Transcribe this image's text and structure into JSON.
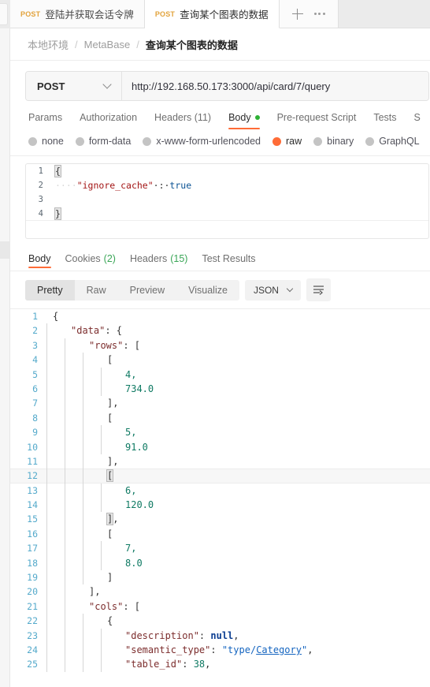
{
  "window": {
    "tabs": [
      {
        "method": "POST",
        "title": "登陆并获取会话令牌",
        "active": false
      },
      {
        "method": "POST",
        "title": "查询某个图表的数据",
        "active": true
      }
    ],
    "new_tab_icon": "plus-icon",
    "more_icon": "ellipsis-icon"
  },
  "breadcrumb": {
    "items": [
      "本地环境",
      "MetaBase",
      "查询某个图表的数据"
    ],
    "separator": "/"
  },
  "request": {
    "method": "POST",
    "url": "http://192.168.50.173:3000/api/card/7/query",
    "tabs": [
      {
        "label": "Params",
        "active": false
      },
      {
        "label": "Authorization",
        "active": false
      },
      {
        "label": "Headers (11)",
        "active": false
      },
      {
        "label": "Body",
        "active": true,
        "dot": true
      },
      {
        "label": "Pre-request Script",
        "active": false
      },
      {
        "label": "Tests",
        "active": false
      },
      {
        "label": "S",
        "active": false
      }
    ],
    "body_types": [
      {
        "label": "none",
        "selected": false
      },
      {
        "label": "form-data",
        "selected": false
      },
      {
        "label": "x-www-form-urlencoded",
        "selected": false
      },
      {
        "label": "raw",
        "selected": true
      },
      {
        "label": "binary",
        "selected": false
      },
      {
        "label": "GraphQL",
        "selected": false
      }
    ],
    "body_lines": [
      {
        "n": "1",
        "text": "{"
      },
      {
        "n": "2",
        "text": "    \"ignore_cache\" : true"
      },
      {
        "n": "3",
        "text": ""
      },
      {
        "n": "4",
        "text": "}"
      }
    ]
  },
  "response": {
    "tabs": [
      {
        "label": "Body",
        "active": true
      },
      {
        "label": "Cookies",
        "count": "(2)",
        "active": false
      },
      {
        "label": "Headers",
        "count": "(15)",
        "active": false
      },
      {
        "label": "Test Results",
        "active": false
      }
    ],
    "view_modes": [
      {
        "label": "Pretty",
        "active": true
      },
      {
        "label": "Raw",
        "active": false
      },
      {
        "label": "Preview",
        "active": false
      },
      {
        "label": "Visualize",
        "active": false
      }
    ],
    "format": "JSON",
    "wrap_icon": "word-wrap-icon",
    "body_lines": [
      {
        "n": "1",
        "indent": 0,
        "parts": [
          {
            "t": "{",
            "c": "j-punc"
          }
        ]
      },
      {
        "n": "2",
        "indent": 1,
        "parts": [
          {
            "t": "\"data\"",
            "c": "j-key"
          },
          {
            "t": ": {",
            "c": "j-punc"
          }
        ]
      },
      {
        "n": "3",
        "indent": 2,
        "parts": [
          {
            "t": "\"rows\"",
            "c": "j-key"
          },
          {
            "t": ": [",
            "c": "j-punc"
          }
        ]
      },
      {
        "n": "4",
        "indent": 3,
        "parts": [
          {
            "t": "[",
            "c": "j-punc"
          }
        ]
      },
      {
        "n": "5",
        "indent": 4,
        "parts": [
          {
            "t": "4,",
            "c": "j-num"
          }
        ]
      },
      {
        "n": "6",
        "indent": 4,
        "parts": [
          {
            "t": "734.0",
            "c": "j-num"
          }
        ]
      },
      {
        "n": "7",
        "indent": 3,
        "parts": [
          {
            "t": "],",
            "c": "j-punc"
          }
        ]
      },
      {
        "n": "8",
        "indent": 3,
        "parts": [
          {
            "t": "[",
            "c": "j-punc"
          }
        ]
      },
      {
        "n": "9",
        "indent": 4,
        "parts": [
          {
            "t": "5,",
            "c": "j-num"
          }
        ]
      },
      {
        "n": "10",
        "indent": 4,
        "parts": [
          {
            "t": "91.0",
            "c": "j-num"
          }
        ]
      },
      {
        "n": "11",
        "indent": 3,
        "parts": [
          {
            "t": "],",
            "c": "j-punc"
          }
        ]
      },
      {
        "n": "12",
        "indent": 3,
        "parts": [
          {
            "t": "[",
            "c": "j-punc brk-hl"
          }
        ],
        "highlight": true
      },
      {
        "n": "13",
        "indent": 4,
        "parts": [
          {
            "t": "6,",
            "c": "j-num"
          }
        ]
      },
      {
        "n": "14",
        "indent": 4,
        "parts": [
          {
            "t": "120.0",
            "c": "j-num"
          }
        ]
      },
      {
        "n": "15",
        "indent": 3,
        "parts": [
          {
            "t": "]",
            "c": "j-punc brk-hl"
          },
          {
            "t": ",",
            "c": "j-punc"
          }
        ]
      },
      {
        "n": "16",
        "indent": 3,
        "parts": [
          {
            "t": "[",
            "c": "j-punc"
          }
        ]
      },
      {
        "n": "17",
        "indent": 4,
        "parts": [
          {
            "t": "7,",
            "c": "j-num"
          }
        ]
      },
      {
        "n": "18",
        "indent": 4,
        "parts": [
          {
            "t": "8.0",
            "c": "j-num"
          }
        ]
      },
      {
        "n": "19",
        "indent": 3,
        "parts": [
          {
            "t": "]",
            "c": "j-punc"
          }
        ]
      },
      {
        "n": "20",
        "indent": 2,
        "parts": [
          {
            "t": "],",
            "c": "j-punc"
          }
        ]
      },
      {
        "n": "21",
        "indent": 2,
        "parts": [
          {
            "t": "\"cols\"",
            "c": "j-key"
          },
          {
            "t": ": [",
            "c": "j-punc"
          }
        ]
      },
      {
        "n": "22",
        "indent": 3,
        "parts": [
          {
            "t": "{",
            "c": "j-punc"
          }
        ]
      },
      {
        "n": "23",
        "indent": 4,
        "parts": [
          {
            "t": "\"description\"",
            "c": "j-key"
          },
          {
            "t": ": ",
            "c": "j-punc"
          },
          {
            "t": "null",
            "c": "j-null"
          },
          {
            "t": ",",
            "c": "j-punc"
          }
        ]
      },
      {
        "n": "24",
        "indent": 4,
        "parts": [
          {
            "t": "\"semantic_type\"",
            "c": "j-key"
          },
          {
            "t": ": ",
            "c": "j-punc"
          },
          {
            "t": "\"type/",
            "c": "j-str"
          },
          {
            "t": "Category",
            "c": "j-link"
          },
          {
            "t": "\"",
            "c": "j-str"
          },
          {
            "t": ",",
            "c": "j-punc"
          }
        ]
      },
      {
        "n": "25",
        "indent": 4,
        "parts": [
          {
            "t": "\"table_id\"",
            "c": "j-key"
          },
          {
            "t": ": ",
            "c": "j-punc"
          },
          {
            "t": "38",
            "c": "j-num"
          },
          {
            "t": ",",
            "c": "j-punc"
          }
        ]
      }
    ]
  }
}
